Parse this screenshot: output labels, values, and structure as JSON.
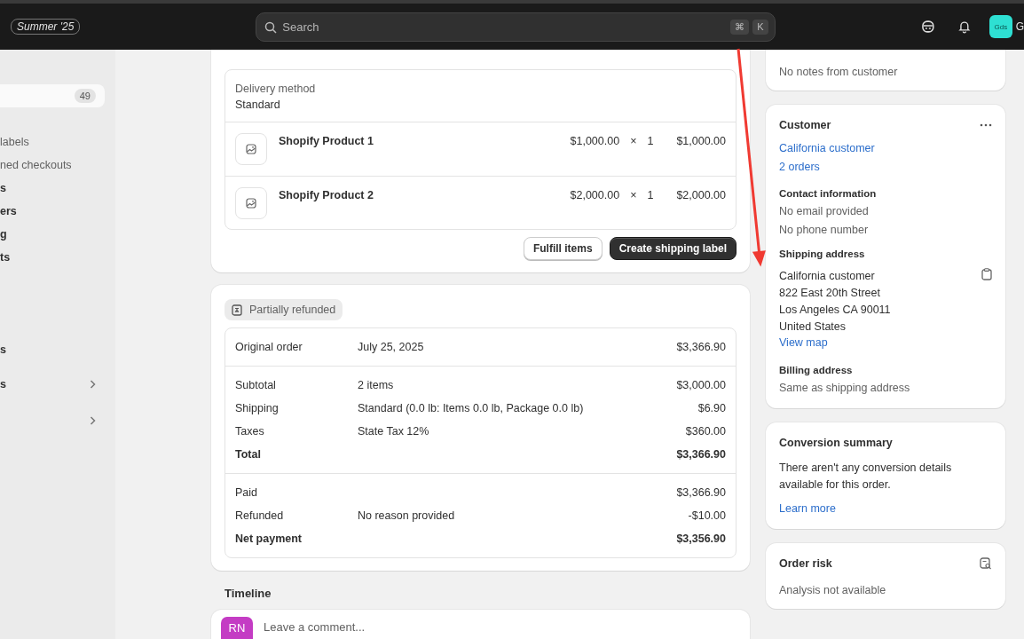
{
  "header": {
    "edition": "Summer '25",
    "search": {
      "placeholder": "Search",
      "shortcut": [
        "⌘",
        "K"
      ]
    },
    "avatar": "Gds",
    "store_name": "G"
  },
  "sidebar": {
    "items": [
      {
        "badge": "49",
        "selected": true,
        "kind": "main",
        "expandable": false
      },
      {
        "label": "labels",
        "selected": false,
        "kind": "sub",
        "expandable": false
      },
      {
        "label": "ned checkouts",
        "selected": false,
        "kind": "sub",
        "expandable": false
      },
      {
        "label": "s",
        "selected": false,
        "kind": "main",
        "expandable": false
      },
      {
        "label": "ers",
        "selected": false,
        "kind": "main",
        "expandable": false
      },
      {
        "label": "g",
        "selected": false,
        "kind": "main",
        "expandable": false
      },
      {
        "label": "ts",
        "selected": false,
        "kind": "main",
        "expandable": false
      },
      {
        "label": "s",
        "selected": false,
        "kind": "main",
        "expandable": false
      },
      {
        "label": "s",
        "selected": false,
        "kind": "main",
        "expandable": true
      },
      {
        "selected": false,
        "kind": "main",
        "expandable": true
      }
    ]
  },
  "fulfillment": {
    "delivery_label": "Delivery method",
    "delivery_value": "Standard",
    "items": [
      {
        "name": "Shopify Product 1",
        "price": "$1,000.00",
        "times": "×",
        "quantity": "1",
        "total": "$1,000.00"
      },
      {
        "name": "Shopify Product 2",
        "price": "$2,000.00",
        "times": "×",
        "quantity": "1",
        "total": "$2,000.00"
      }
    ],
    "buttons": [
      {
        "label": "Fulfill items",
        "kind": "secondary"
      },
      {
        "label": "Create shipping label",
        "kind": "primary"
      }
    ]
  },
  "payment": {
    "status": "Partially refunded",
    "sections": [
      [
        {
          "label": "Original order",
          "detail": "July 25, 2025",
          "amount": "$3,366.90",
          "bold": false
        }
      ],
      [
        {
          "label": "Subtotal",
          "detail": "2 items",
          "amount": "$3,000.00",
          "bold": false
        },
        {
          "label": "Shipping",
          "detail": "Standard (0.0 lb: Items 0.0 lb, Package 0.0 lb)",
          "amount": "$6.90",
          "bold": false
        },
        {
          "label": "Taxes",
          "detail": "State Tax 12%",
          "amount": "$360.00",
          "bold": false
        },
        {
          "label": "Total",
          "amount": "$3,366.90",
          "bold": true
        }
      ],
      [
        {
          "label": "Paid",
          "amount": "$3,366.90",
          "bold": false
        },
        {
          "label": "Refunded",
          "detail": "No reason provided",
          "amount": "-$10.00",
          "bold": false
        },
        {
          "label": "Net payment",
          "amount": "$3,356.90",
          "bold": true
        }
      ]
    ]
  },
  "timeline": {
    "title": "Timeline",
    "avatar": "RN",
    "placeholder": "Leave a comment..."
  },
  "notes": {
    "text": "No notes from customer"
  },
  "customer": {
    "title": "Customer",
    "name": "California customer",
    "orders": "2 orders",
    "contact_title": "Contact information",
    "contact": [
      "No email provided",
      "No phone number"
    ],
    "shipping_title": "Shipping address",
    "address": [
      "California customer",
      "822 East 20th Street",
      "Los Angeles CA 90011",
      "United States"
    ],
    "map_link": "View map",
    "billing_title": "Billing address",
    "billing": "Same as shipping address"
  },
  "conversion": {
    "title": "Conversion summary",
    "text": "There aren't any conversion details available for this order.",
    "link": "Learn more"
  },
  "risk": {
    "title": "Order risk",
    "text": "Analysis not available"
  }
}
